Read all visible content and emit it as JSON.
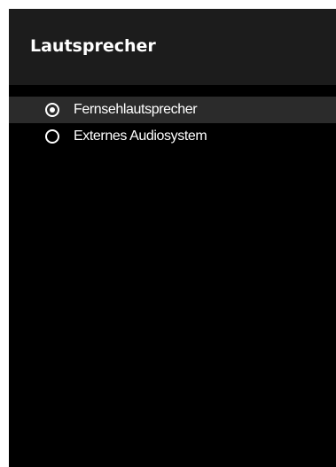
{
  "dialog": {
    "title": "Lautsprecher",
    "options": [
      {
        "label": "Fernsehlautsprecher",
        "selected": true,
        "icon": "radio-selected-icon"
      },
      {
        "label": "Externes Audiosystem",
        "selected": false,
        "icon": "radio-unselected-icon"
      }
    ]
  },
  "colors": {
    "background": "#000000",
    "header": "#1c1c1c",
    "highlight": "#2b2b2b",
    "text": "#ffffff"
  }
}
